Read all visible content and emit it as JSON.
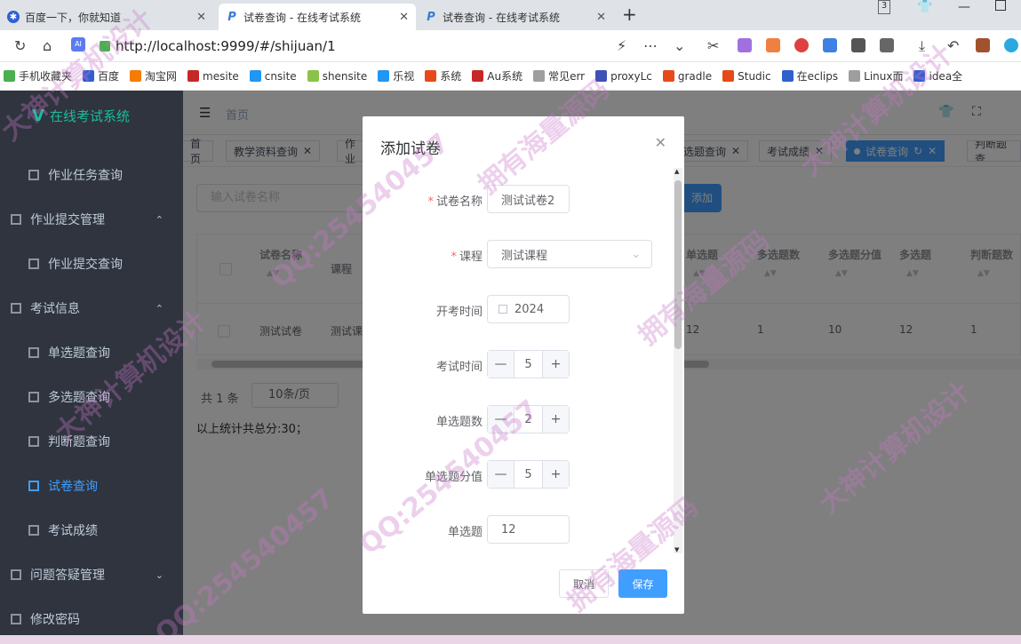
{
  "browser": {
    "tabs": [
      {
        "label": "百度一下，你就知道",
        "active": false,
        "icon": "baidu-icon"
      },
      {
        "label": "试卷查询 - 在线考试系统",
        "active": true,
        "icon": "p-icon"
      },
      {
        "label": "试卷查询 - 在线考试系统",
        "active": false,
        "icon": "p-icon"
      }
    ],
    "new_tab": "+",
    "window_badge": "3",
    "url": "http://localhost:9999/#/shijuan/1",
    "bookmarks": [
      "手机收藏夹",
      "百度",
      "淘宝网",
      "mesite",
      "cnsite",
      "shensite",
      "乐视",
      "系统",
      "Au系统",
      "常见err",
      "proxyLc",
      "gradle",
      "Studic",
      "在eclips",
      "Linux面",
      "idea全"
    ]
  },
  "sidebar": {
    "logo": "在线考试系统",
    "items": [
      {
        "label": "作业任务查询",
        "type": "sub"
      },
      {
        "label": "作业提交管理",
        "type": "group"
      },
      {
        "label": "作业提交查询",
        "type": "sub"
      },
      {
        "label": "考试信息",
        "type": "group"
      },
      {
        "label": "单选题查询",
        "type": "sub"
      },
      {
        "label": "多选题查询",
        "type": "sub"
      },
      {
        "label": "判断题查询",
        "type": "sub"
      },
      {
        "label": "试卷查询",
        "type": "sub",
        "active": true
      },
      {
        "label": "考试成绩",
        "type": "sub"
      },
      {
        "label": "问题答疑管理",
        "type": "group"
      },
      {
        "label": "修改密码",
        "type": "group"
      }
    ]
  },
  "header": {
    "breadcrumb": "首页"
  },
  "tags": [
    "首页",
    "教学资料查询",
    "作业",
    "选题查询",
    "考试成绩",
    "试卷查询",
    "判断题查"
  ],
  "search": {
    "placeholder": "输入试卷名称",
    "add_label": "添加"
  },
  "table": {
    "headers": [
      "试卷名称",
      "课程",
      "单选题",
      "多选题数",
      "多选题分值",
      "多选题",
      "判断题数"
    ],
    "row": [
      "测试试卷",
      "测试课",
      "12",
      "1",
      "10",
      "12",
      "1"
    ]
  },
  "pagination": {
    "total": "共 1 条",
    "page_size": "10条/页"
  },
  "summary": "以上统计共总分:30；",
  "dialog": {
    "title": "添加试卷",
    "fields": {
      "name": {
        "label": "试卷名称",
        "value": "测试试卷2",
        "required": true
      },
      "course": {
        "label": "课程",
        "value": "测试课程",
        "required": true
      },
      "start_time": {
        "label": "开考时间",
        "value": "2024"
      },
      "duration": {
        "label": "考试时间",
        "value": "5"
      },
      "single_count": {
        "label": "单选题数",
        "value": "2"
      },
      "single_score": {
        "label": "单选题分值",
        "value": "5"
      },
      "single_questions": {
        "label": "单选题",
        "value": "12"
      }
    },
    "cancel_label": "取消",
    "save_label": "保存"
  },
  "watermark": [
    "大神计算机设计",
    "QQ:254540457",
    "拥有海量源码"
  ],
  "colors": {
    "primary": "#409eff",
    "sidebar": "#2f343e",
    "logo": "#1abc9c"
  }
}
